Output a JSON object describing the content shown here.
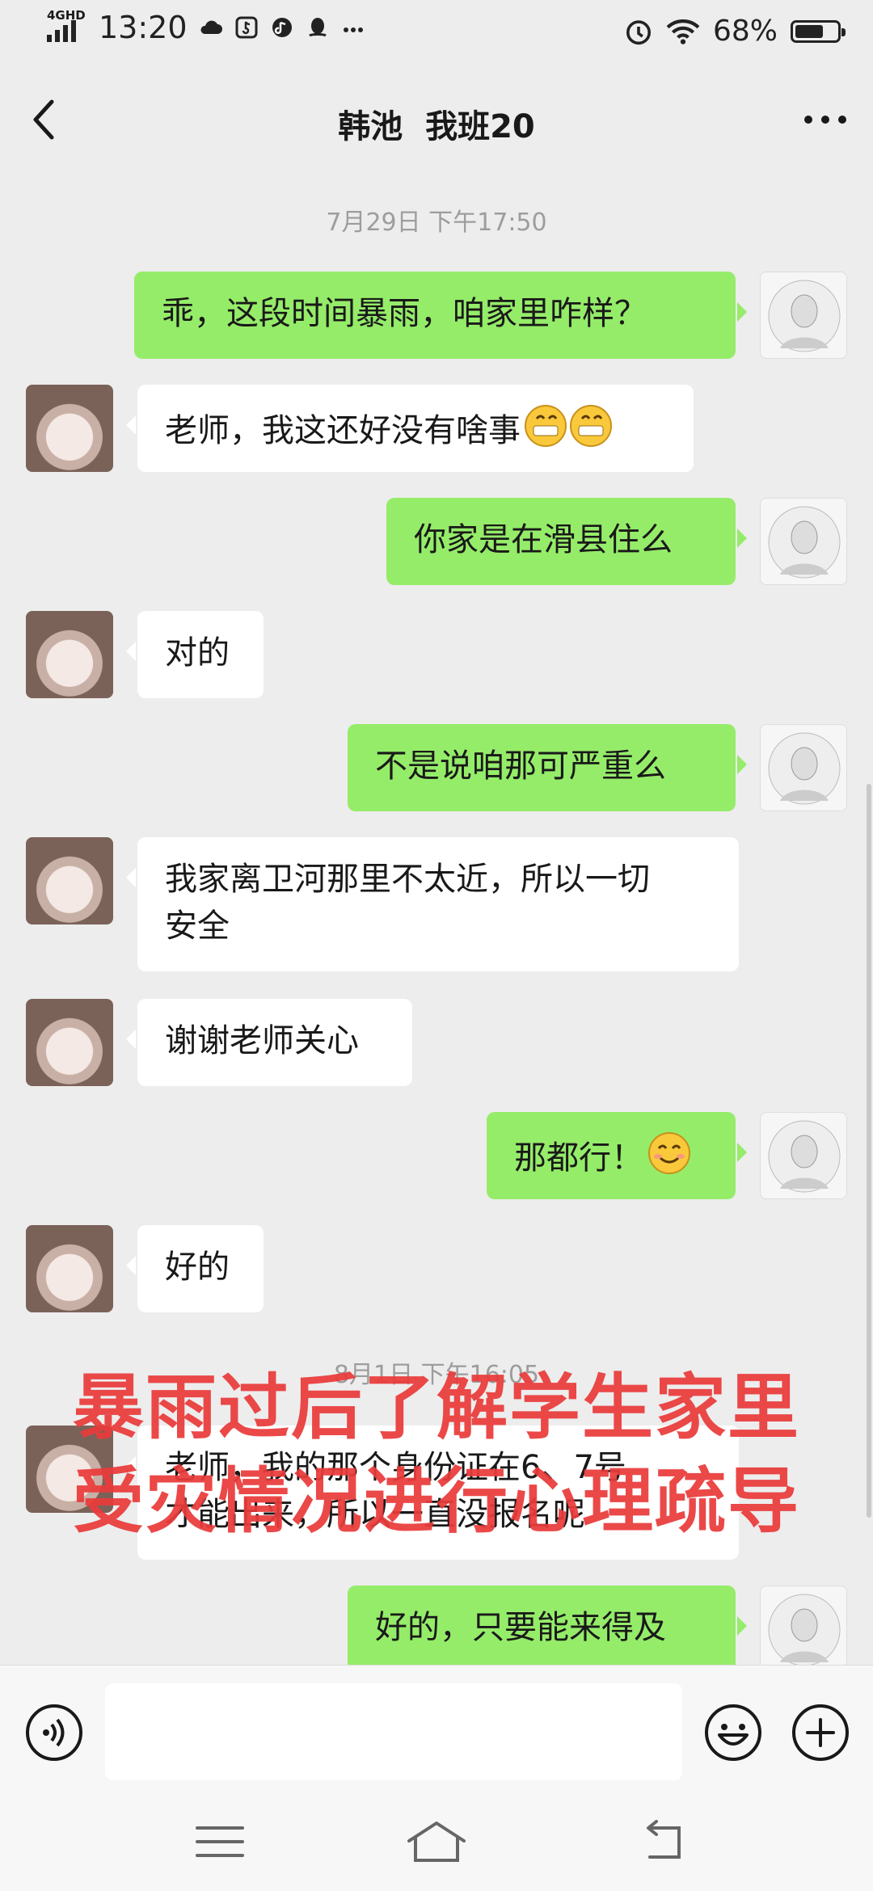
{
  "status_bar": {
    "network": "4GHD",
    "time": "13:20",
    "battery": "68%",
    "battery_level": 0.68,
    "icons": [
      "cloud-icon",
      "tiktok-icon",
      "music-icon",
      "qq-icon",
      "more-dots-icon",
      "alarm-icon",
      "wifi-icon"
    ]
  },
  "header": {
    "title": "韩池  我班20",
    "back_icon": "back-icon",
    "more_icon": "more-icon"
  },
  "messages": [
    {
      "type": "timestamp",
      "text": "7月29日 下午17:50"
    },
    {
      "side": "right",
      "text": "乖，这段时间暴雨，咱家里咋样？"
    },
    {
      "side": "left",
      "text": "老师，我这还好没有啥事",
      "emoji": "grin-emoji"
    },
    {
      "side": "right",
      "text": "你家是在滑县住么"
    },
    {
      "side": "left",
      "text": "对的"
    },
    {
      "side": "right",
      "text": "不是说咱那可严重么"
    },
    {
      "side": "left",
      "line1": "我家离卫河那里不太近，所以一切",
      "line2": "安全"
    },
    {
      "side": "left",
      "text": "谢谢老师关心"
    },
    {
      "side": "right",
      "text": "那都行！",
      "emoji": "smile-emoji"
    },
    {
      "side": "left",
      "text": "好的"
    },
    {
      "type": "timestamp",
      "text": "8月1日 下午16:05"
    },
    {
      "side": "left",
      "line1": "老师，我的那个身份证在6、7号",
      "line2": "才能出来，所以一直没报名呢"
    },
    {
      "side": "right",
      "text": "好的，只要能来得及"
    }
  ],
  "overlay": {
    "line1": "暴雨过后了解学生家里",
    "line2": "受灾情况进行心理疏导"
  },
  "input_bar": {
    "voice_icon": "voice-icon",
    "emoji_icon": "emoji-icon",
    "plus_icon": "plus-icon",
    "value": ""
  },
  "nav_bar": {
    "icons": [
      "menu-icon",
      "home-icon",
      "return-icon"
    ]
  },
  "colors": {
    "background": "#ededed",
    "my_bubble": "#95ec69",
    "their_bubble": "#ffffff",
    "overlay_text": "#ea3b3b",
    "timestamp": "#9d9d9d"
  }
}
